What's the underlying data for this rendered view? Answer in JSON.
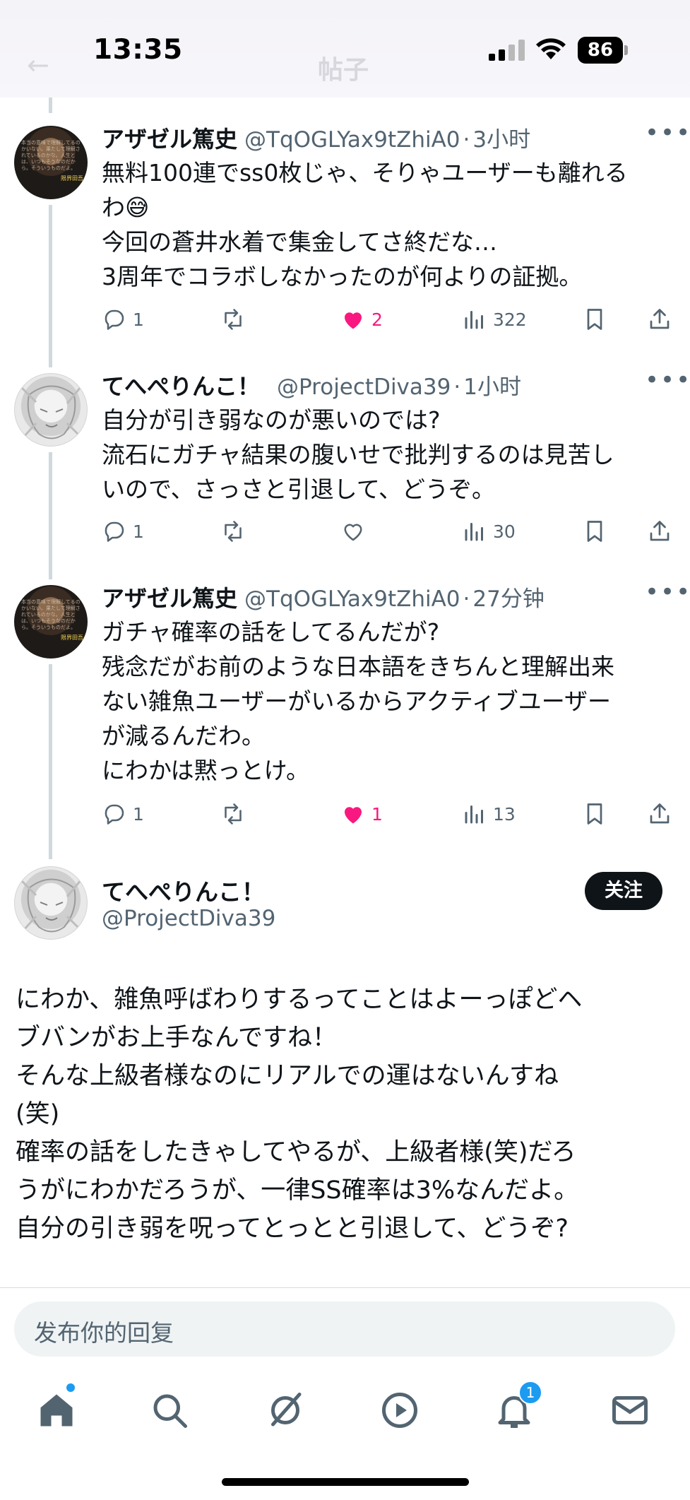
{
  "status_bar": {
    "time": "13:35",
    "battery": "86"
  },
  "header": {
    "back_glyph": "←",
    "title": "帖子"
  },
  "thread": [
    {
      "name": "アザゼル篤史",
      "handle": "@TqOGLYax9tZhiA0",
      "time": "3小时",
      "lines": [
        "無料100連でss0枚じゃ、そりゃユーザーも離れる",
        "わ😅",
        "今回の蒼井水着で集金してさ終だな…",
        "3周年でコラボしなかったのが何よりの証拠。"
      ],
      "replies": "1",
      "retweets": "",
      "likes": "2",
      "liked": true,
      "views": "322"
    },
    {
      "name": "てへぺりんこ！",
      "handle": "@ProjectDiva39",
      "time": "1小时",
      "lines": [
        "自分が引き弱なのが悪いのでは?",
        "流石にガチャ結果の腹いせで批判するのは見苦し",
        "いので、さっさと引退して、どうぞ。"
      ],
      "replies": "1",
      "retweets": "",
      "likes": "",
      "liked": false,
      "views": "30"
    },
    {
      "name": "アザゼル篤史",
      "handle": "@TqOGLYax9tZhiA0",
      "time": "27分钟",
      "lines": [
        "ガチャ確率の話をしてるんだが?",
        "残念だがお前のような日本語をきちんと理解出来",
        "ない雑魚ユーザーがいるからアクティブユーザー",
        "が減るんだわ。",
        "にわかは黙っとけ。"
      ],
      "replies": "1",
      "retweets": "",
      "likes": "1",
      "liked": true,
      "views": "13"
    }
  ],
  "main_post": {
    "name": "てへぺりんこ！",
    "handle": "@ProjectDiva39",
    "follow_label": "关注",
    "lines": [
      "にわか、雑魚呼ばわりするってことはよーっぽどヘ",
      "ブバンがお上手なんですね！",
      "そんな上級者様なのにリアルでの運はないんすね",
      "(笑)",
      "確率の話をしたきゃしてやるが、上級者様(笑)だろ",
      "うがにわかだろうが、一律SS確率は3%なんだよ。",
      "自分の引き弱を呪ってとっとと引退して、どうぞ?"
    ]
  },
  "reply_box": {
    "placeholder": "发布你的回复"
  },
  "tab_bar": {
    "notifications_badge": "1"
  },
  "colors": {
    "like": "#f91880",
    "accent": "#1d9bf0",
    "muted": "#536471",
    "text": "#0f1419"
  }
}
